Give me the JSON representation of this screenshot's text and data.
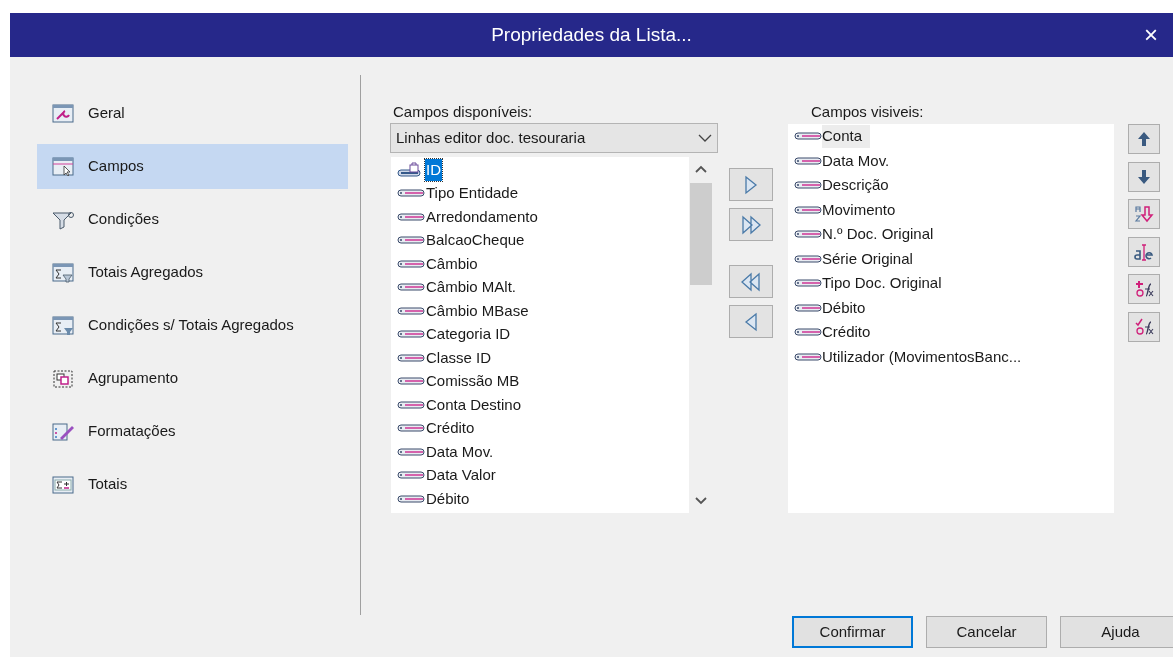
{
  "window": {
    "title": "Propriedades da Lista...",
    "close": "×"
  },
  "sidebar": {
    "items": [
      {
        "label": "Geral",
        "selected": false
      },
      {
        "label": "Campos",
        "selected": true
      },
      {
        "label": "Condições",
        "selected": false
      },
      {
        "label": "Totais Agregados",
        "selected": false
      },
      {
        "label": "Condições s/ Totais Agregados",
        "selected": false
      },
      {
        "label": "Agrupamento",
        "selected": false
      },
      {
        "label": "Formatações",
        "selected": false
      },
      {
        "label": "Totais",
        "selected": false
      }
    ]
  },
  "available": {
    "label": "Campos disponíveis:",
    "source": "Linhas editor doc. tesouraria",
    "items": [
      {
        "label": "ID",
        "kind": "key",
        "selected": true
      },
      {
        "label": "Tipo Entidade",
        "kind": "field",
        "selected": false
      },
      {
        "label": "Arredondamento",
        "kind": "field",
        "selected": false
      },
      {
        "label": "BalcaoCheque",
        "kind": "field",
        "selected": false
      },
      {
        "label": "Câmbio",
        "kind": "field",
        "selected": false
      },
      {
        "label": "Câmbio MAlt.",
        "kind": "field",
        "selected": false
      },
      {
        "label": "Câmbio MBase",
        "kind": "field",
        "selected": false
      },
      {
        "label": "Categoria ID",
        "kind": "field",
        "selected": false
      },
      {
        "label": "Classe ID",
        "kind": "field",
        "selected": false
      },
      {
        "label": "Comissão MB",
        "kind": "field",
        "selected": false
      },
      {
        "label": "Conta Destino",
        "kind": "field",
        "selected": false
      },
      {
        "label": "Crédito",
        "kind": "field",
        "selected": false
      },
      {
        "label": "Data Mov.",
        "kind": "field",
        "selected": false
      },
      {
        "label": "Data Valor",
        "kind": "field",
        "selected": false
      },
      {
        "label": "Débito",
        "kind": "field",
        "selected": false
      }
    ]
  },
  "visible": {
    "label": "Campos visiveis:",
    "items": [
      {
        "label": "Conta",
        "selected": true
      },
      {
        "label": "Data Mov.",
        "selected": false
      },
      {
        "label": "Descrição",
        "selected": false
      },
      {
        "label": "Movimento",
        "selected": false
      },
      {
        "label": "N.º Doc. Original",
        "selected": false
      },
      {
        "label": "Série Original",
        "selected": false
      },
      {
        "label": "Tipo Doc. Original",
        "selected": false
      },
      {
        "label": "Débito",
        "selected": false
      },
      {
        "label": "Crédito",
        "selected": false
      },
      {
        "label": "Utilizador (MovimentosBanc...",
        "selected": false
      }
    ]
  },
  "buttons": [
    {
      "label": "Confirmar",
      "default": true
    },
    {
      "label": "Cancelar",
      "default": false
    },
    {
      "label": "Ajuda",
      "default": false
    }
  ]
}
